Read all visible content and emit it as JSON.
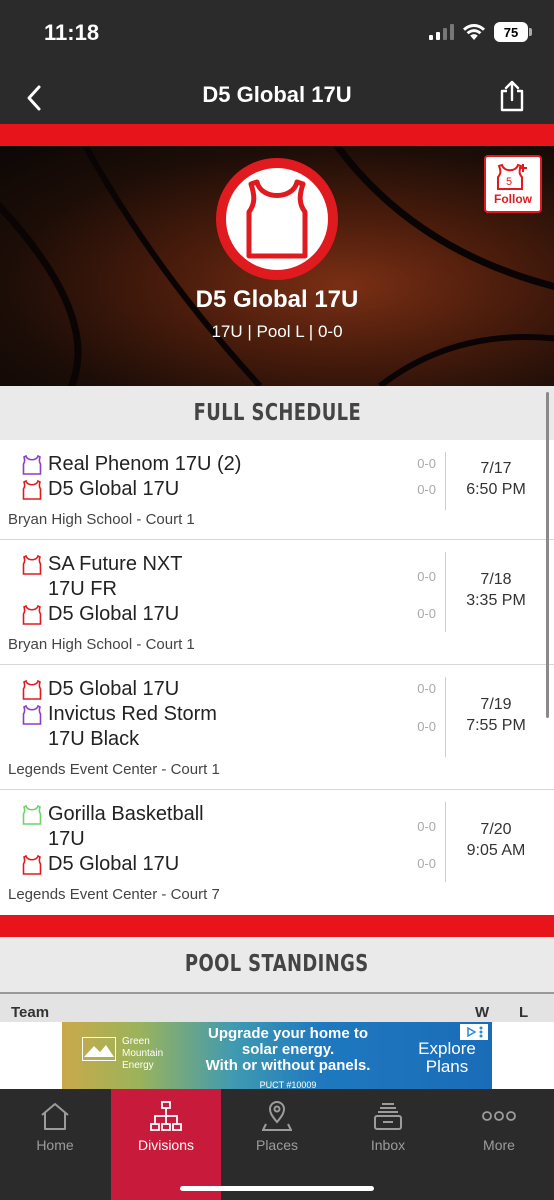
{
  "status_bar": {
    "time": "11:18",
    "battery": "75"
  },
  "nav": {
    "title": "D5 Global 17U"
  },
  "hero": {
    "team_name": "D5 Global 17U",
    "subtitle": "17U | Pool L | 0-0",
    "follow_label": "Follow",
    "follow_icon_text": "5"
  },
  "colors": {
    "accent_red": "#e8141b",
    "tab_active": "#c81b3c",
    "jersey_purple": "#8e3fc1",
    "jersey_red": "#e01b20",
    "jersey_green": "#6fd36b"
  },
  "schedule": {
    "title": "FULL SCHEDULE",
    "games": [
      {
        "team1": "Real Phenom 17U (2)",
        "team1_jersey_color": "#8e3fc1",
        "score1": "0-0",
        "team2": "D5 Global 17U",
        "team2_jersey_color": "#e01b20",
        "score2": "0-0",
        "date": "7/17",
        "time": "6:50 PM",
        "venue": "Bryan High School - Court 1"
      },
      {
        "team1": "SA Future NXT 17U FR",
        "team1_jersey_color": "#e01b20",
        "score1": "0-0",
        "team2": "D5 Global 17U",
        "team2_jersey_color": "#e01b20",
        "score2": "0-0",
        "date": "7/18",
        "time": "3:35 PM",
        "venue": "Bryan High School - Court 1"
      },
      {
        "team1": "D5 Global 17U",
        "team1_jersey_color": "#e01b20",
        "score1": "0-0",
        "team2": "Invictus Red Storm 17U Black",
        "team2_jersey_color": "#8e3fc1",
        "score2": "0-0",
        "date": "7/19",
        "time": "7:55 PM",
        "venue": "Legends Event Center - Court 1"
      },
      {
        "team1": "Gorilla Basketball 17U",
        "team1_jersey_color": "#6fd36b",
        "score1": "0-0",
        "team2": "D5 Global 17U",
        "team2_jersey_color": "#e01b20",
        "score2": "0-0",
        "date": "7/20",
        "time": "9:05 AM",
        "venue": "Legends Event Center - Court 7"
      }
    ]
  },
  "standings": {
    "title": "POOL STANDINGS",
    "col_team": "Team",
    "col_w": "W",
    "col_l": "L"
  },
  "ad": {
    "brand_line1": "Green",
    "brand_line2": "Mountain",
    "brand_line3": "Energy",
    "headline_line1": "Upgrade your home to",
    "headline_line2": "solar energy.",
    "headline_line3": "With or without panels.",
    "fine_print": "PUCT #10009",
    "cta_line1": "Explore",
    "cta_line2": "Plans"
  },
  "tabs": [
    {
      "label": "Home",
      "icon": "home-icon"
    },
    {
      "label": "Divisions",
      "icon": "bracket-icon"
    },
    {
      "label": "Places",
      "icon": "map-pin-icon"
    },
    {
      "label": "Inbox",
      "icon": "inbox-icon"
    },
    {
      "label": "More",
      "icon": "more-icon"
    }
  ]
}
